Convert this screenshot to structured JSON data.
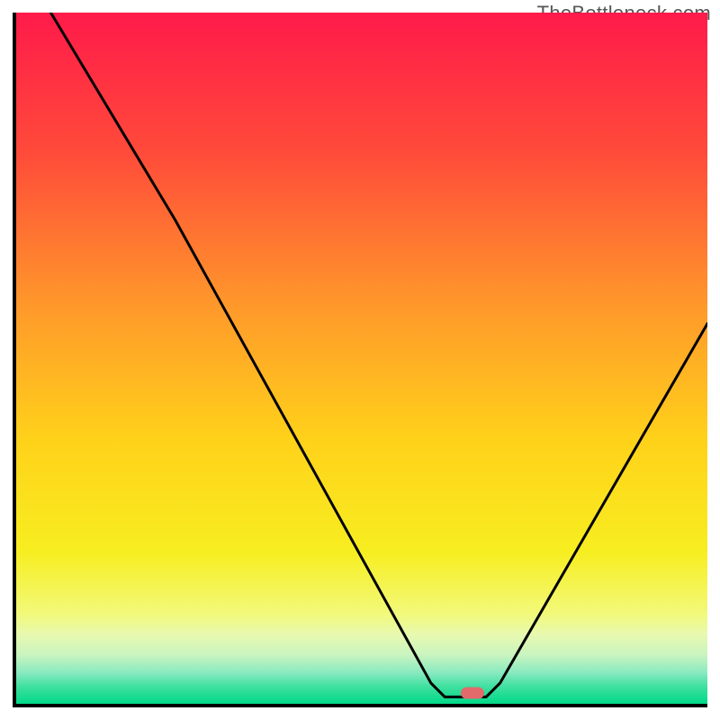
{
  "watermark": "TheBottleneck.com",
  "chart_data": {
    "type": "line",
    "title": "",
    "xlabel": "",
    "ylabel": "",
    "xlim": [
      0,
      100
    ],
    "ylim": [
      0,
      100
    ],
    "curve": [
      {
        "x": 5,
        "y": 100
      },
      {
        "x": 23,
        "y": 70
      },
      {
        "x": 60,
        "y": 3
      },
      {
        "x": 62,
        "y": 1
      },
      {
        "x": 68,
        "y": 1
      },
      {
        "x": 70,
        "y": 3
      },
      {
        "x": 100,
        "y": 55
      }
    ],
    "marker": {
      "x": 66,
      "y": 1.5,
      "color": "#e26a6a"
    },
    "gradient_stops": [
      {
        "offset": 0.0,
        "color": "#ff1a4a"
      },
      {
        "offset": 0.2,
        "color": "#ff4a3a"
      },
      {
        "offset": 0.43,
        "color": "#ff9a2a"
      },
      {
        "offset": 0.62,
        "color": "#ffd21a"
      },
      {
        "offset": 0.78,
        "color": "#f7ee20"
      },
      {
        "offset": 0.87,
        "color": "#f2f97a"
      },
      {
        "offset": 0.9,
        "color": "#e8f9b0"
      },
      {
        "offset": 0.93,
        "color": "#c8f4c0"
      },
      {
        "offset": 0.955,
        "color": "#88eac0"
      },
      {
        "offset": 0.975,
        "color": "#40e0a0"
      },
      {
        "offset": 1.0,
        "color": "#00d988"
      }
    ]
  }
}
